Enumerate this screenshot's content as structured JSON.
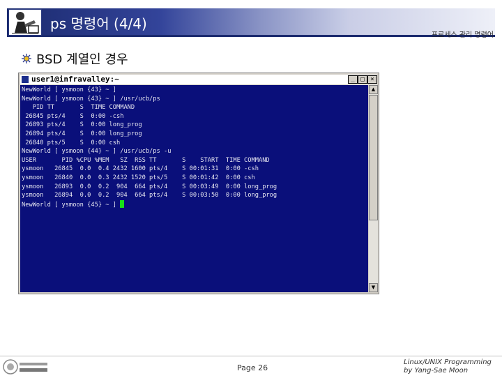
{
  "header": {
    "title": "ps 명령어 (4/4)",
    "chapter": "프로세스 관리 명령어"
  },
  "section": {
    "heading": "BSD 계열인 경우"
  },
  "window": {
    "title": "user1@infravalley:~",
    "buttons": {
      "minimize": "_",
      "maximize": "□",
      "close": "×"
    },
    "cursor_color": "#18e018",
    "background_color": "#0a0f7a",
    "terminal_lines": [
      "NewWorld [ ysmoon {43} ~ ]",
      "NewWorld [ ysmoon {43} ~ ] /usr/ucb/ps",
      "   PID TT       S  TIME COMMAND",
      " 26845 pts/4    S  0:00 -csh",
      " 26893 pts/4    S  0:00 long_prog",
      " 26894 pts/4    S  0:00 long_prog",
      " 26840 pts/5    S  0:00 csh",
      "NewWorld [ ysmoon {44} ~ ] /usr/ucb/ps -u",
      "USER       PID %CPU %MEM   SZ  RSS TT       S    START  TIME COMMAND",
      "ysmoon   26845  0.0  0.4 2432 1600 pts/4    S 00:01:31  0:00 -csh",
      "ysmoon   26840  0.0  0.3 2432 1520 pts/5    S 00:01:42  0:00 csh",
      "ysmoon   26893  0.0  0.2  904  664 pts/4    S 00:03:49  0:00 long_prog",
      "ysmoon   26894  0.0  0.2  904  664 pts/4    S 00:03:50  0:00 long_prog"
    ],
    "prompt_line": "NewWorld [ ysmoon {45} ~ ] "
  },
  "footer": {
    "page": "Page 26",
    "book_line1": "Linux/UNIX Programming",
    "book_line2": "by Yang-Sae Moon"
  },
  "icons": {
    "header_logo": "person-at-computer-icon",
    "bullet": "sun-bullet-icon",
    "footer_logo": "university-logo"
  }
}
